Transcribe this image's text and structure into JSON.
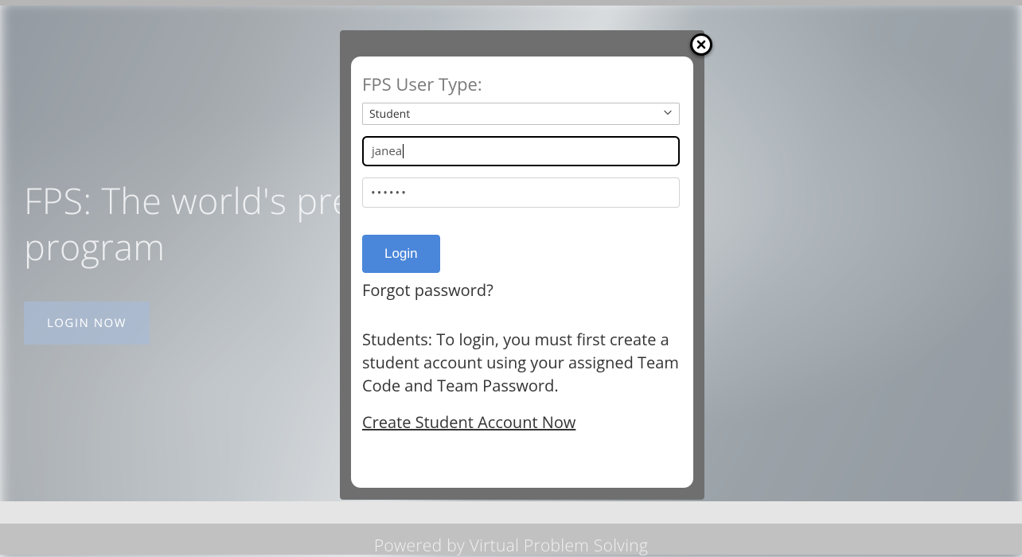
{
  "hero": {
    "headline": "FPS: The world's premier problem solving program",
    "login_button": "LOGIN NOW"
  },
  "footer": {
    "text": "Powered by Virtual Problem Solving"
  },
  "modal": {
    "user_type_label": "FPS User Type:",
    "user_type_selected": "Student",
    "username_value": "janea",
    "password_value": "••••••",
    "login_button": "Login",
    "forgot_password": "Forgot password?",
    "student_info": "Students: To login, you must first create a student account using your assigned Team Code and Team Password.",
    "create_account": "Create Student Account Now"
  }
}
